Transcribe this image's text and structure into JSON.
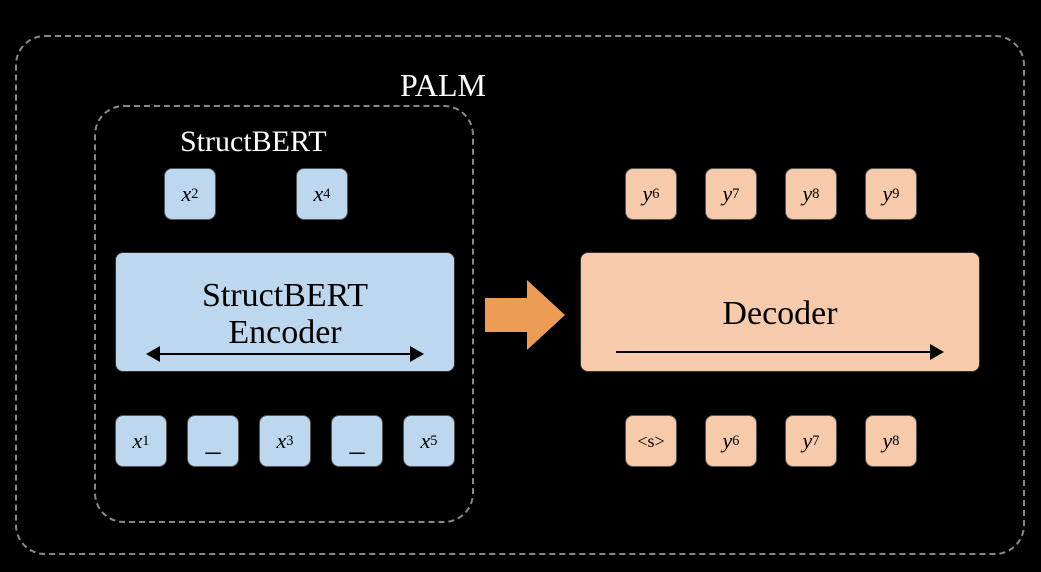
{
  "outer_label": "PALM",
  "inner_label": "StructBERT",
  "encoder": {
    "line1": "StructBERT",
    "line2": "Encoder",
    "top_tokens": [
      {
        "var": "x",
        "sub": "2"
      },
      {
        "var": "x",
        "sub": "4"
      }
    ],
    "bottom_tokens": [
      {
        "var": "x",
        "sub": "1"
      },
      {
        "literal": "_"
      },
      {
        "var": "x",
        "sub": "3"
      },
      {
        "literal": "_"
      },
      {
        "var": "x",
        "sub": "5"
      }
    ]
  },
  "decoder": {
    "label": "Decoder",
    "top_tokens": [
      {
        "var": "y",
        "sub": "6"
      },
      {
        "var": "y",
        "sub": "7"
      },
      {
        "var": "y",
        "sub": "8"
      },
      {
        "var": "y",
        "sub": "9"
      }
    ],
    "bottom_tokens": [
      {
        "literal": "<s>"
      },
      {
        "var": "y",
        "sub": "6"
      },
      {
        "var": "y",
        "sub": "7"
      },
      {
        "var": "y",
        "sub": "8"
      }
    ]
  }
}
